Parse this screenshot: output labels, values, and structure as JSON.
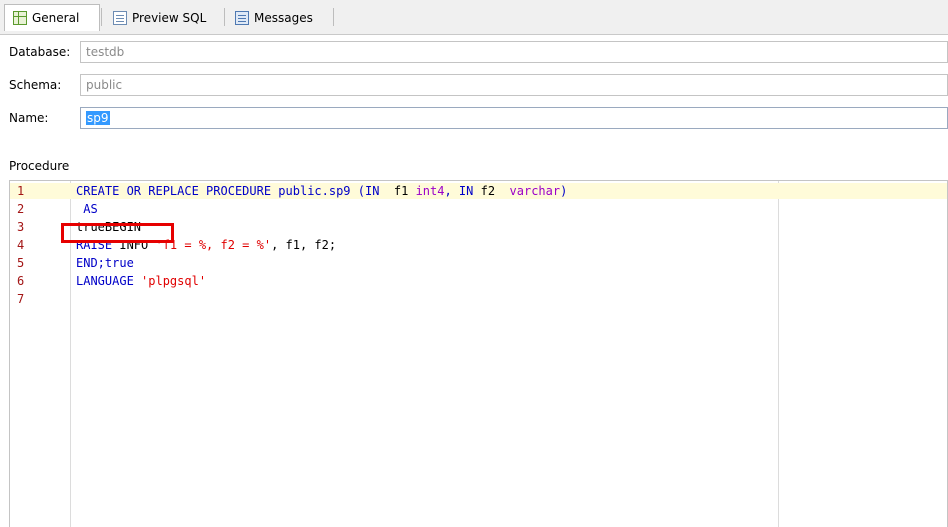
{
  "tabs": [
    {
      "label": "General",
      "icon": "grid-icon",
      "active": true
    },
    {
      "label": "Preview SQL",
      "icon": "document-icon",
      "active": false
    },
    {
      "label": "Messages",
      "icon": "messages-icon",
      "active": false
    }
  ],
  "fields": {
    "database": {
      "label": "Database:",
      "value": "testdb"
    },
    "schema": {
      "label": "Schema:",
      "value": "public"
    },
    "name": {
      "label": "Name:",
      "value": "sp9"
    }
  },
  "procedure": {
    "label": "Procedure",
    "lines": [
      {
        "num": "1",
        "text": "CREATE OR REPLACE PROCEDURE public.sp9 (IN  f1 int4, IN f2  varchar)"
      },
      {
        "num": "2",
        "text": " AS"
      },
      {
        "num": "3",
        "text": "trueBEGIN"
      },
      {
        "num": "4",
        "text": "RAISE INFO 'f1 = %, f2 = %', f1, f2;"
      },
      {
        "num": "5",
        "text": "END;true"
      },
      {
        "num": "6",
        "text": "LANGUAGE 'plpgsql'"
      },
      {
        "num": "7",
        "text": ""
      }
    ]
  },
  "colors": {
    "keyword": "#0000c8",
    "type": "#9b00c8",
    "string": "#e00000",
    "line_number": "#a31515",
    "current_line": "#fffbd9",
    "annotation_box": "#e60000"
  }
}
